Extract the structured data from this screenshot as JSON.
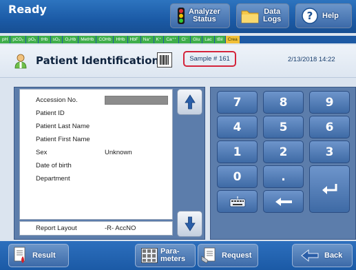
{
  "header": {
    "status": "Ready",
    "buttons": {
      "analyzer_status_line1": "Analyzer",
      "analyzer_status_line2": "Status",
      "data_logs_line1": "Data",
      "data_logs_line2": "Logs",
      "help": "Help"
    }
  },
  "parameters": [
    "pH",
    "pCO₂",
    "pO₂",
    "tHb",
    "sO₂",
    "O₂Hb",
    "MetHb",
    "COHb",
    "HHb",
    "HbF",
    "Na⁺",
    "K⁺",
    "Ca⁺⁺",
    "Cl⁻",
    "Glu",
    "Lac",
    "tBil",
    "Crea"
  ],
  "patient_header": {
    "title": "Patient Identification",
    "sample": "Sample # 161",
    "datetime": "2/13/2018 14:22"
  },
  "patient_fields": {
    "accession_label": "Accession No.",
    "patient_id_label": "Patient ID",
    "last_name_label": "Patient Last Name",
    "first_name_label": "Patient First Name",
    "sex_label": "Sex",
    "sex_value": "Unknown",
    "dob_label": "Date of birth",
    "department_label": "Department"
  },
  "report_layout": {
    "label": "Report Layout",
    "value": "-R- AccNO"
  },
  "keypad": [
    "7",
    "8",
    "9",
    "4",
    "5",
    "6",
    "1",
    "2",
    "3",
    "0",
    "."
  ],
  "footer": {
    "result": "Result",
    "parameters_line1": "Para-",
    "parameters_line2": "meters",
    "request": "Request",
    "back": "Back"
  },
  "colors": {
    "param_active": "#3fae4a",
    "param_crea": "#f2c038",
    "highlight_border": "#d4233a",
    "panel_blue": "#5c7dab"
  }
}
